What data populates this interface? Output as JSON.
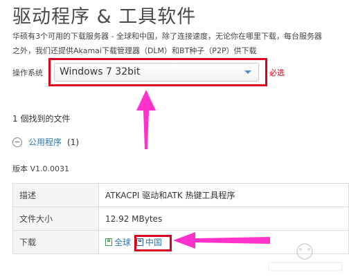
{
  "page": {
    "title": "驱动程序 & 工具软件",
    "intro_line1": "华硕有3个可用的下载服务器 - 全球和中国，除了连接速度，无论你在哪里下载，每台服务器",
    "intro_line2": "之外，我们还提供Akamai下载管理器（DLM）和BT种子（P2P）供下载"
  },
  "os_selector": {
    "label": "操作系统",
    "value": "Windows 7 32bit",
    "required_text": "必选"
  },
  "results": {
    "found_text": "1 個找到的文件",
    "category_label": "公用程序",
    "category_count": "(1)"
  },
  "file": {
    "version": "版本 V1.0.0031",
    "rows": [
      {
        "key": "描述",
        "value": "ATKACPI 驱动和ATK 热键工具程序"
      },
      {
        "key": "文件大小",
        "value": "12.92 MBytes"
      },
      {
        "key": "下载",
        "value": ""
      }
    ],
    "download_global": "全球",
    "download_china": "中国"
  },
  "colors": {
    "highlight": "#d9001b",
    "arrow": "#ff33cc",
    "link": "#2a7ab0"
  }
}
